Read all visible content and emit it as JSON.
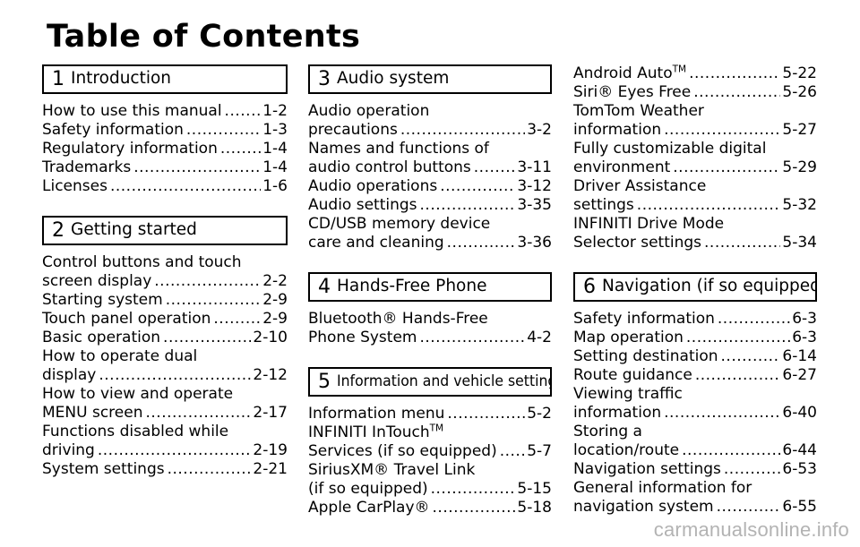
{
  "page": {
    "title": "Table of Contents",
    "watermark": "carmanualsonline.info"
  },
  "columns": [
    {
      "id": "column-1",
      "blocks": [
        {
          "type": "section",
          "number": "1",
          "title": "Introduction"
        },
        {
          "type": "entries",
          "items": [
            {
              "lines": [
                "How to use this manual"
              ],
              "page": "1-2"
            },
            {
              "lines": [
                "Safety information"
              ],
              "page": "1-3"
            },
            {
              "lines": [
                "Regulatory information"
              ],
              "page": "1-4"
            },
            {
              "lines": [
                "Trademarks"
              ],
              "page": "1-4"
            },
            {
              "lines": [
                "Licenses"
              ],
              "page": "1-6"
            }
          ]
        },
        {
          "type": "section",
          "number": "2",
          "title": "Getting started"
        },
        {
          "type": "entries",
          "items": [
            {
              "lines": [
                "Control buttons and touch",
                "screen display"
              ],
              "page": "2-2"
            },
            {
              "lines": [
                "Starting system"
              ],
              "page": "2-9"
            },
            {
              "lines": [
                "Touch panel operation"
              ],
              "page": "2-9"
            },
            {
              "lines": [
                "Basic operation"
              ],
              "page": "2-10"
            },
            {
              "lines": [
                "How to operate dual",
                "display"
              ],
              "page": "2-12"
            },
            {
              "lines": [
                "How to view and operate",
                "MENU screen"
              ],
              "page": "2-17"
            },
            {
              "lines": [
                "Functions disabled while",
                "driving"
              ],
              "page": "2-19"
            },
            {
              "lines": [
                "System settings"
              ],
              "page": "2-21"
            }
          ]
        }
      ]
    },
    {
      "id": "column-2",
      "blocks": [
        {
          "type": "section",
          "number": "3",
          "title": "Audio system"
        },
        {
          "type": "entries",
          "items": [
            {
              "lines": [
                "Audio operation",
                "precautions"
              ],
              "page": "3-2"
            },
            {
              "lines": [
                "Names and functions of",
                "audio control buttons"
              ],
              "page": "3-11"
            },
            {
              "lines": [
                "Audio operations"
              ],
              "page": "3-12"
            },
            {
              "lines": [
                "Audio settings"
              ],
              "page": "3-35"
            },
            {
              "lines": [
                "CD/USB memory device",
                "care and cleaning"
              ],
              "page": "3-36"
            }
          ]
        },
        {
          "type": "section",
          "number": "4",
          "title": "Hands-Free Phone"
        },
        {
          "type": "entries",
          "items": [
            {
              "lines": [
                "Bluetooth® Hands-Free",
                "Phone System"
              ],
              "page": "4-2"
            }
          ]
        },
        {
          "type": "section",
          "number": "5",
          "title": "Information and vehicle settings",
          "condensed": true
        },
        {
          "type": "entries",
          "items": [
            {
              "lines": [
                "Information menu"
              ],
              "page": "5-2"
            },
            {
              "lines": [
                "INFINITI InTouch|TM",
                "Services (if so equipped)"
              ],
              "page": "5-7"
            },
            {
              "lines": [
                "SiriusXM® Travel Link",
                "(if so equipped)"
              ],
              "page": "5-15"
            },
            {
              "lines": [
                "Apple CarPlay®"
              ],
              "page": "5-18"
            }
          ]
        }
      ]
    },
    {
      "id": "column-3",
      "blocks": [
        {
          "type": "entries",
          "items": [
            {
              "lines": [
                "Android Auto|TM"
              ],
              "page": "5-22"
            },
            {
              "lines": [
                "Siri® Eyes Free"
              ],
              "page": "5-26"
            },
            {
              "lines": [
                "TomTom Weather",
                "information"
              ],
              "page": "5-27"
            },
            {
              "lines": [
                "Fully customizable digital",
                "environment"
              ],
              "page": "5-29"
            },
            {
              "lines": [
                "Driver Assistance",
                "settings"
              ],
              "page": "5-32"
            },
            {
              "lines": [
                "INFINITI Drive Mode",
                "Selector settings"
              ],
              "page": "5-34"
            }
          ]
        },
        {
          "type": "section",
          "number": "6",
          "title": "Navigation (if so equipped)"
        },
        {
          "type": "entries",
          "items": [
            {
              "lines": [
                "Safety information"
              ],
              "page": "6-3"
            },
            {
              "lines": [
                "Map operation"
              ],
              "page": "6-3"
            },
            {
              "lines": [
                "Setting destination"
              ],
              "page": "6-14"
            },
            {
              "lines": [
                "Route guidance"
              ],
              "page": "6-27"
            },
            {
              "lines": [
                "Viewing traffic",
                "information"
              ],
              "page": "6-40"
            },
            {
              "lines": [
                "Storing a",
                "location/route"
              ],
              "page": "6-44"
            },
            {
              "lines": [
                "Navigation settings"
              ],
              "page": "6-53"
            },
            {
              "lines": [
                "General information for",
                "navigation system"
              ],
              "page": "6-55"
            }
          ]
        }
      ]
    }
  ]
}
